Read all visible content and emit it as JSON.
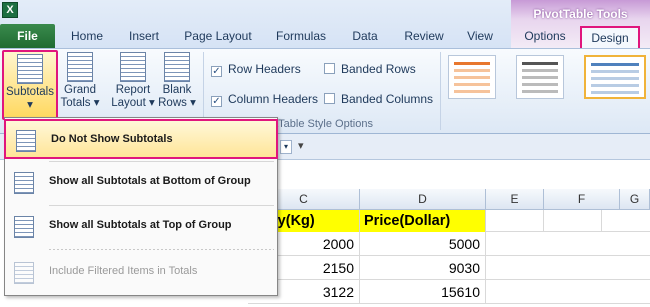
{
  "app": {
    "icon_letter": "X"
  },
  "tabs": {
    "file": "File",
    "items": [
      "Home",
      "Insert",
      "Page Layout",
      "Formulas",
      "Data",
      "Review",
      "View"
    ],
    "context_group": "PivotTable Tools",
    "options": "Options",
    "design": "Design"
  },
  "ribbon": {
    "subtotals_label": "Subtotals",
    "grand_totals_label_1": "Grand",
    "grand_totals_label_2": "Totals",
    "report_layout_label_1": "Report",
    "report_layout_label_2": "Layout",
    "blank_rows_label_1": "Blank",
    "blank_rows_label_2": "Rows",
    "row_headers": "Row Headers",
    "column_headers": "Column Headers",
    "banded_rows": "Banded Rows",
    "banded_columns": "Banded Columns",
    "style_options_group": "otTable Style Options",
    "row_headers_checked": true,
    "column_headers_checked": true
  },
  "menu": {
    "do_not_show": "Do Not Show Subtotals",
    "show_bottom": "Show all Subtotals at Bottom of Group",
    "show_top": "Show all Subtotals at Top of Group",
    "include_filtered": "Include Filtered Items in Totals"
  },
  "grid": {
    "col_c": "C",
    "col_d": "D",
    "col_e": "E",
    "col_f": "F",
    "col_g": "G",
    "header_c": "tity(Kg)",
    "header_d": "Price(Dollar)",
    "rows": [
      {
        "c": "2000",
        "d": "5000"
      },
      {
        "c": "2150",
        "d": "9030"
      },
      {
        "c": "3122",
        "d": "15610"
      }
    ]
  },
  "colors": {
    "highlight": "#e0167d",
    "excel_green": "#1d6f42",
    "header_yellow": "#ffff00"
  }
}
